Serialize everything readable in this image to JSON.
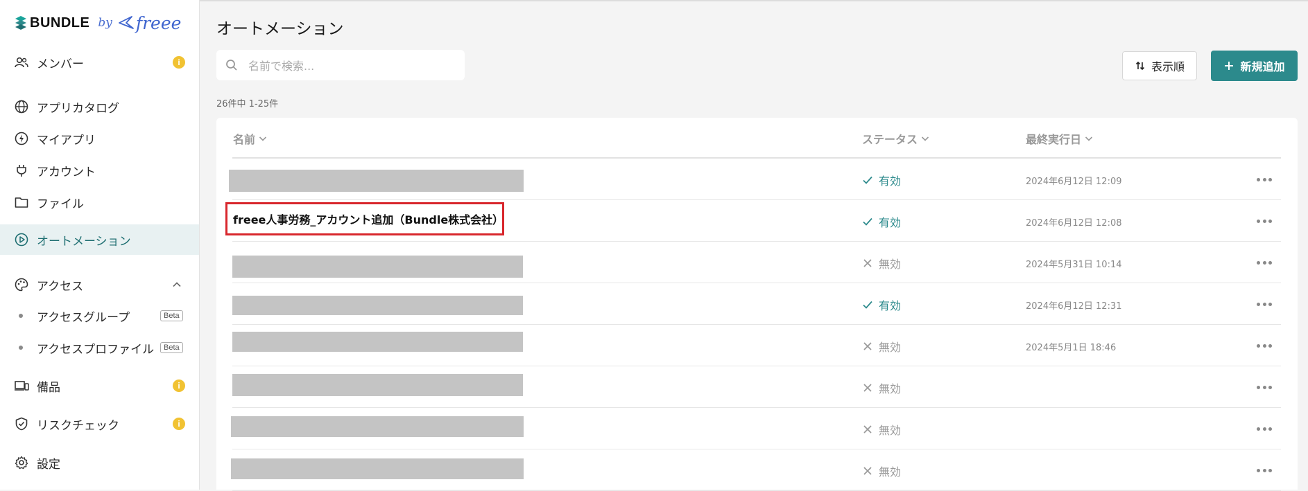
{
  "brand": {
    "name": "BUNDLE",
    "by": "by",
    "partner": "freee"
  },
  "sidebar": {
    "items": [
      {
        "label": "メンバー",
        "icon": "members-icon",
        "badge": "i"
      },
      {
        "label": "アプリカタログ",
        "icon": "globe-icon"
      },
      {
        "label": "マイアプリ",
        "icon": "lightning-icon"
      },
      {
        "label": "アカウント",
        "icon": "plug-icon"
      },
      {
        "label": "ファイル",
        "icon": "folder-icon"
      },
      {
        "label": "オートメーション",
        "icon": "play-circle-icon",
        "active": true
      },
      {
        "label": "アクセス",
        "icon": "palette-icon",
        "expanded": true
      },
      {
        "label": "アクセスグループ",
        "tag": "Beta"
      },
      {
        "label": "アクセスプロファイル",
        "tag": "Beta"
      },
      {
        "label": "備品",
        "icon": "devices-icon",
        "badge": "i"
      },
      {
        "label": "リスクチェック",
        "icon": "shield-check-icon",
        "badge": "i"
      },
      {
        "label": "設定",
        "icon": "gear-icon"
      }
    ]
  },
  "main": {
    "title": "オートメーション",
    "search": {
      "placeholder": "名前で検索..."
    },
    "sort_label": "表示順",
    "add_label": "新規追加",
    "count": "26件中 1-25件",
    "columns": {
      "name": "名前",
      "status": "ステータス",
      "last_run": "最終実行日"
    },
    "rows": [
      {
        "name": "",
        "status": "有効",
        "enabled": true,
        "last_run": "2024年6月12日 12:09"
      },
      {
        "name": "freee人事労務_アカウント追加（Bundle株式会社）",
        "status": "有効",
        "enabled": true,
        "last_run": "2024年6月12日 12:08"
      },
      {
        "name": "",
        "status": "無効",
        "enabled": false,
        "last_run": "2024年5月31日 10:14"
      },
      {
        "name": "",
        "status": "有効",
        "enabled": true,
        "last_run": "2024年6月12日 12:31"
      },
      {
        "name": "",
        "status": "無効",
        "enabled": false,
        "last_run": "2024年5月1日 18:46"
      },
      {
        "name": "",
        "status": "無効",
        "enabled": false,
        "last_run": ""
      },
      {
        "name": "",
        "status": "無効",
        "enabled": false,
        "last_run": ""
      },
      {
        "name": "",
        "status": "無効",
        "enabled": false,
        "last_run": ""
      }
    ]
  },
  "colors": {
    "accent": "#2c8a8c",
    "highlight_border": "#d8262c",
    "info_badge": "#f1c232",
    "redaction": "#c4c4c4"
  }
}
